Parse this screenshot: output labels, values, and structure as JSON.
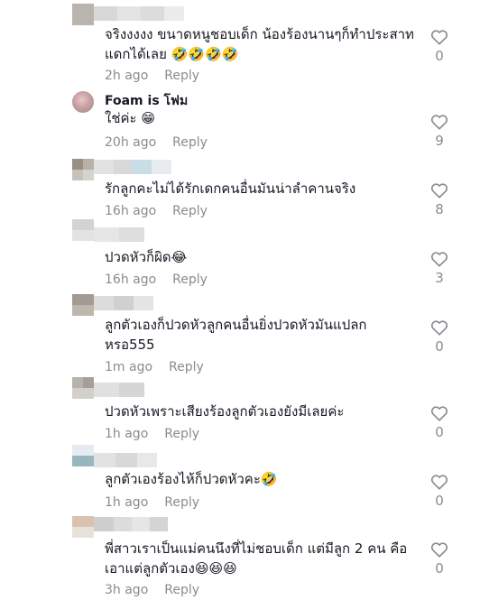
{
  "comments": [
    {
      "name": "",
      "text": "จริงงงงง ขนาดหนูชอบเด็ก น้องร้องนานๆก็ทำประสาทแดกได้เลย 🤣🤣🤣🤣",
      "time": "2h ago",
      "reply": "Reply",
      "likes": "0"
    },
    {
      "name": "Foam is โฟม",
      "text": "ใช่ค่ะ 😁",
      "time": "20h ago",
      "reply": "Reply",
      "likes": "9"
    },
    {
      "name": "",
      "text": "รักลูกคะไม่ได้รักเดกคนอื่นมันน่าลำคานจริง",
      "time": "16h ago",
      "reply": "Reply",
      "likes": "8"
    },
    {
      "name": "",
      "text": "ปวดหัวก็ผิด😂",
      "time": "16h ago",
      "reply": "Reply",
      "likes": "3"
    },
    {
      "name": "",
      "text": "ลูกตัวเองก็ปวดหัวลูกคนอื่นยิ่งปวดหัวมันแปลกหรอ555",
      "time": "1m ago",
      "reply": "Reply",
      "likes": "0"
    },
    {
      "name": "",
      "text": "ปวดหัวเพราะเสียงร้องลูกตัวเองยังมีเลยค่ะ",
      "time": "1h ago",
      "reply": "Reply",
      "likes": "0"
    },
    {
      "name": "",
      "text": "ลูกตัวเองร้องไห้ก็ปวดหัวคะ🤣",
      "time": "1h ago",
      "reply": "Reply",
      "likes": "0"
    },
    {
      "name": "",
      "text": "พี่สาวเราเป็นแม่คนนึงที่ไม่ชอบเด็ก แต่มีลูก 2 คน คือเอาแต่ลูกตัวเอง😆😆😆",
      "time": "3h ago",
      "reply": "Reply",
      "likes": "0"
    }
  ],
  "icons": {
    "like": "heart-outline-icon"
  },
  "colors": {
    "text": "#161823",
    "meta": "#8a8b91"
  }
}
